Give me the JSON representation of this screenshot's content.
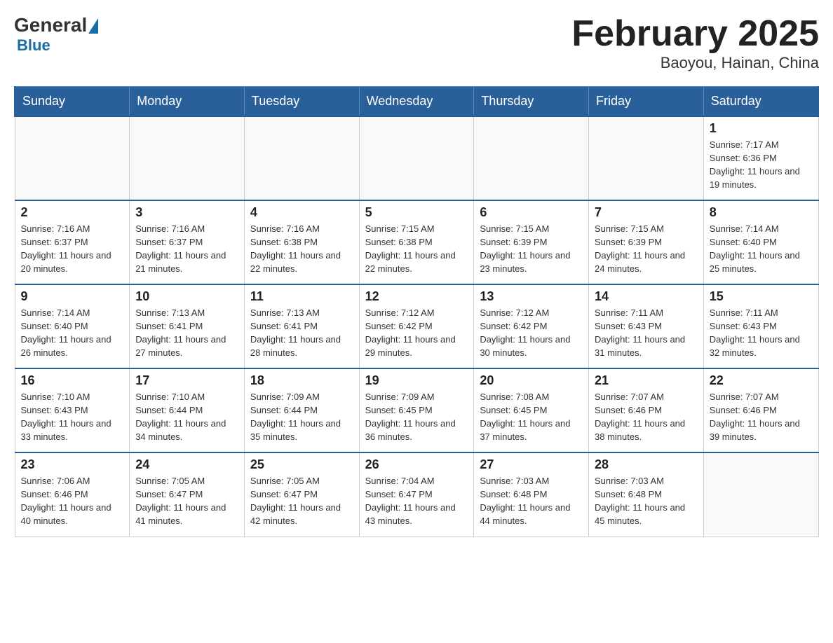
{
  "header": {
    "logo": {
      "general": "General",
      "blue": "Blue"
    },
    "title": "February 2025",
    "location": "Baoyou, Hainan, China"
  },
  "weekdays": [
    "Sunday",
    "Monday",
    "Tuesday",
    "Wednesday",
    "Thursday",
    "Friday",
    "Saturday"
  ],
  "weeks": [
    [
      {
        "day": "",
        "info": ""
      },
      {
        "day": "",
        "info": ""
      },
      {
        "day": "",
        "info": ""
      },
      {
        "day": "",
        "info": ""
      },
      {
        "day": "",
        "info": ""
      },
      {
        "day": "",
        "info": ""
      },
      {
        "day": "1",
        "info": "Sunrise: 7:17 AM\nSunset: 6:36 PM\nDaylight: 11 hours and 19 minutes."
      }
    ],
    [
      {
        "day": "2",
        "info": "Sunrise: 7:16 AM\nSunset: 6:37 PM\nDaylight: 11 hours and 20 minutes."
      },
      {
        "day": "3",
        "info": "Sunrise: 7:16 AM\nSunset: 6:37 PM\nDaylight: 11 hours and 21 minutes."
      },
      {
        "day": "4",
        "info": "Sunrise: 7:16 AM\nSunset: 6:38 PM\nDaylight: 11 hours and 22 minutes."
      },
      {
        "day": "5",
        "info": "Sunrise: 7:15 AM\nSunset: 6:38 PM\nDaylight: 11 hours and 22 minutes."
      },
      {
        "day": "6",
        "info": "Sunrise: 7:15 AM\nSunset: 6:39 PM\nDaylight: 11 hours and 23 minutes."
      },
      {
        "day": "7",
        "info": "Sunrise: 7:15 AM\nSunset: 6:39 PM\nDaylight: 11 hours and 24 minutes."
      },
      {
        "day": "8",
        "info": "Sunrise: 7:14 AM\nSunset: 6:40 PM\nDaylight: 11 hours and 25 minutes."
      }
    ],
    [
      {
        "day": "9",
        "info": "Sunrise: 7:14 AM\nSunset: 6:40 PM\nDaylight: 11 hours and 26 minutes."
      },
      {
        "day": "10",
        "info": "Sunrise: 7:13 AM\nSunset: 6:41 PM\nDaylight: 11 hours and 27 minutes."
      },
      {
        "day": "11",
        "info": "Sunrise: 7:13 AM\nSunset: 6:41 PM\nDaylight: 11 hours and 28 minutes."
      },
      {
        "day": "12",
        "info": "Sunrise: 7:12 AM\nSunset: 6:42 PM\nDaylight: 11 hours and 29 minutes."
      },
      {
        "day": "13",
        "info": "Sunrise: 7:12 AM\nSunset: 6:42 PM\nDaylight: 11 hours and 30 minutes."
      },
      {
        "day": "14",
        "info": "Sunrise: 7:11 AM\nSunset: 6:43 PM\nDaylight: 11 hours and 31 minutes."
      },
      {
        "day": "15",
        "info": "Sunrise: 7:11 AM\nSunset: 6:43 PM\nDaylight: 11 hours and 32 minutes."
      }
    ],
    [
      {
        "day": "16",
        "info": "Sunrise: 7:10 AM\nSunset: 6:43 PM\nDaylight: 11 hours and 33 minutes."
      },
      {
        "day": "17",
        "info": "Sunrise: 7:10 AM\nSunset: 6:44 PM\nDaylight: 11 hours and 34 minutes."
      },
      {
        "day": "18",
        "info": "Sunrise: 7:09 AM\nSunset: 6:44 PM\nDaylight: 11 hours and 35 minutes."
      },
      {
        "day": "19",
        "info": "Sunrise: 7:09 AM\nSunset: 6:45 PM\nDaylight: 11 hours and 36 minutes."
      },
      {
        "day": "20",
        "info": "Sunrise: 7:08 AM\nSunset: 6:45 PM\nDaylight: 11 hours and 37 minutes."
      },
      {
        "day": "21",
        "info": "Sunrise: 7:07 AM\nSunset: 6:46 PM\nDaylight: 11 hours and 38 minutes."
      },
      {
        "day": "22",
        "info": "Sunrise: 7:07 AM\nSunset: 6:46 PM\nDaylight: 11 hours and 39 minutes."
      }
    ],
    [
      {
        "day": "23",
        "info": "Sunrise: 7:06 AM\nSunset: 6:46 PM\nDaylight: 11 hours and 40 minutes."
      },
      {
        "day": "24",
        "info": "Sunrise: 7:05 AM\nSunset: 6:47 PM\nDaylight: 11 hours and 41 minutes."
      },
      {
        "day": "25",
        "info": "Sunrise: 7:05 AM\nSunset: 6:47 PM\nDaylight: 11 hours and 42 minutes."
      },
      {
        "day": "26",
        "info": "Sunrise: 7:04 AM\nSunset: 6:47 PM\nDaylight: 11 hours and 43 minutes."
      },
      {
        "day": "27",
        "info": "Sunrise: 7:03 AM\nSunset: 6:48 PM\nDaylight: 11 hours and 44 minutes."
      },
      {
        "day": "28",
        "info": "Sunrise: 7:03 AM\nSunset: 6:48 PM\nDaylight: 11 hours and 45 minutes."
      },
      {
        "day": "",
        "info": ""
      }
    ]
  ]
}
